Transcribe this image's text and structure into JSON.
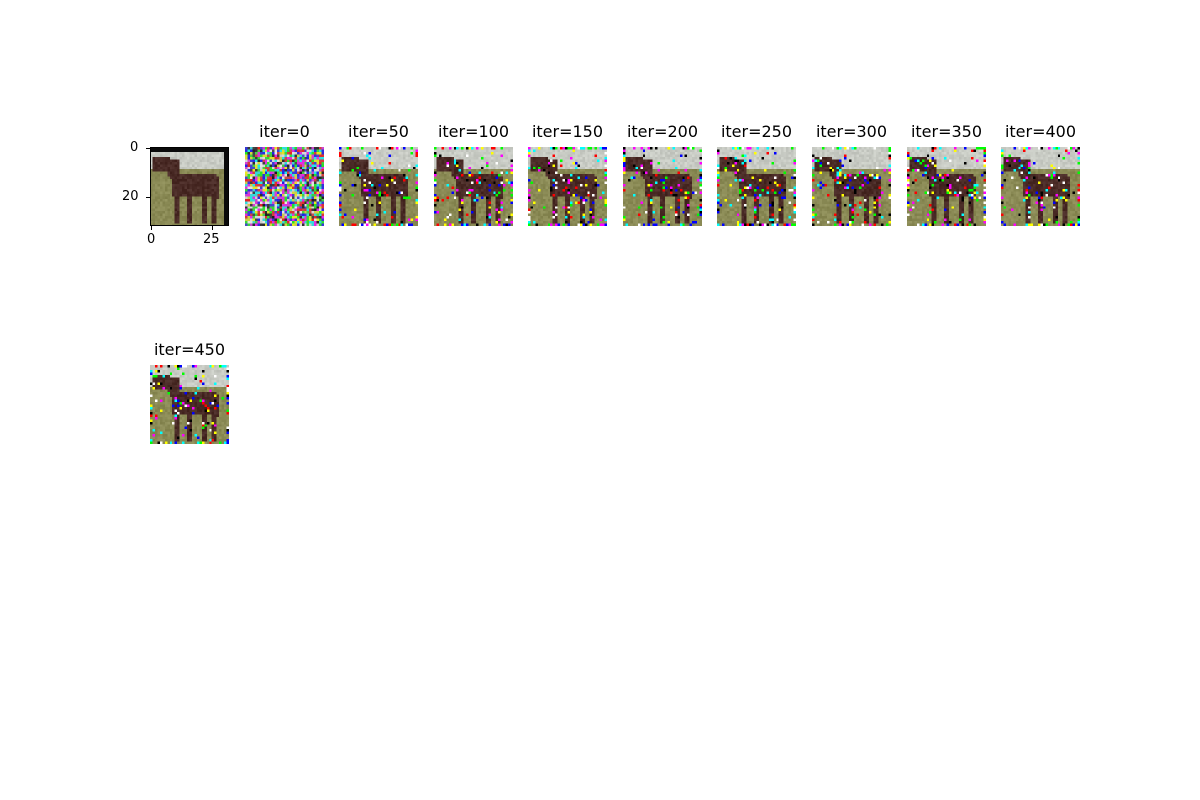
{
  "original": {
    "y_ticks": [
      "0",
      "20"
    ],
    "x_ticks": [
      "0",
      "25"
    ]
  },
  "panels": [
    {
      "title": "iter=0",
      "kind": "noise"
    },
    {
      "title": "iter=50",
      "kind": "recon"
    },
    {
      "title": "iter=100",
      "kind": "recon"
    },
    {
      "title": "iter=150",
      "kind": "recon"
    },
    {
      "title": "iter=200",
      "kind": "recon"
    },
    {
      "title": "iter=250",
      "kind": "recon"
    },
    {
      "title": "iter=300",
      "kind": "recon"
    },
    {
      "title": "iter=350",
      "kind": "recon"
    },
    {
      "title": "iter=400",
      "kind": "recon"
    },
    {
      "title": "iter=450",
      "kind": "recon"
    }
  ],
  "colors": {
    "sky": "#c8cbc4",
    "grass": "#8a8a55",
    "horse": "#4a2b26",
    "border": "#000000"
  }
}
